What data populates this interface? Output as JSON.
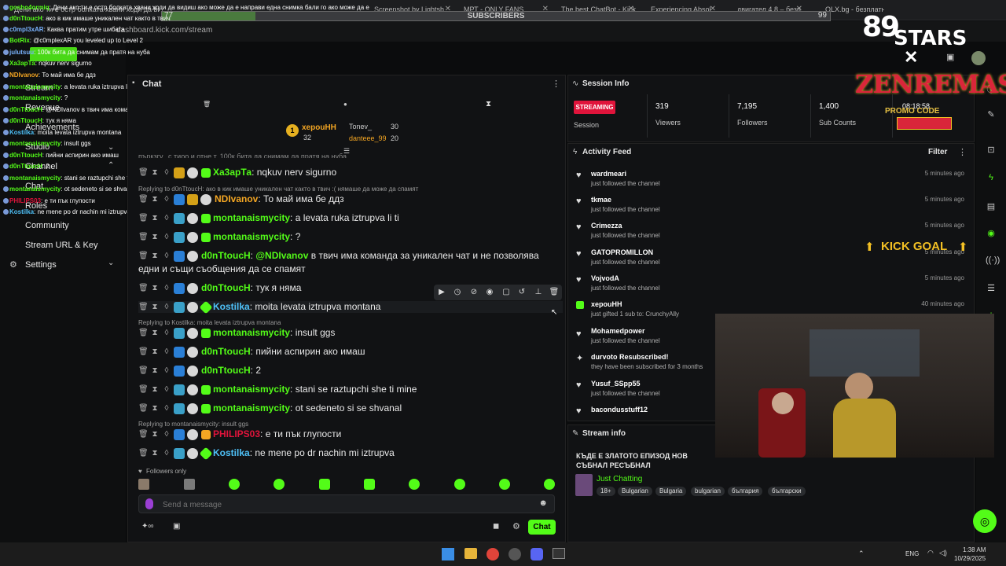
{
  "browser": {
    "tabs": [
      {
        "label": "Дени ако ти е остр болката хвани ходи да видиш ако може да е направи една снимка бали го ако може да е"
      },
      {
        "label": "Screenshot by Lightsh"
      },
      {
        "label": "МРТ - ONLY FANS"
      },
      {
        "label": "The best ChatBot - Kick..."
      },
      {
        "label": "Experiencing Absol..."
      },
      {
        "label": "двигател 4.8 – безп..."
      },
      {
        "label": "OLX.bg - безплатни..."
      }
    ],
    "url": "dashboard.kick.com/stream"
  },
  "subs_goal": {
    "label": "SUBSCRIBERS",
    "current": "77",
    "goal": "99",
    "progress": 0.14
  },
  "sidebar": {
    "items": [
      {
        "label": "Stream"
      },
      {
        "label": "Revenue"
      },
      {
        "label": "Achievements"
      },
      {
        "label": "Studio"
      },
      {
        "label": "Channel"
      },
      {
        "label": "Chat"
      },
      {
        "label": "Roles"
      },
      {
        "label": "Community"
      },
      {
        "label": "Stream URL & Key"
      },
      {
        "label": "Settings"
      }
    ]
  },
  "overlay_chat": [
    {
      "name": "gosho4ormiq",
      "text": ": Дени ако ти е остр болката хвани ходи да видиш ако може да е направи една снимка бали го ако може да е"
    },
    {
      "name": "d0nTtoucH",
      "text": ": ако в кик имаше уникален чат както в твич"
    },
    {
      "name": "c0mpl3xAR",
      "text": ": Каква пратим утре шибата"
    },
    {
      "name": "BotRix",
      "text": ": @c0mplexAR you leveled up to Level 2"
    },
    {
      "name": "julutsuu",
      "text": ": 100к бита да снимам да пратя на нуба"
    },
    {
      "name": "Ха3арТа",
      "text": ": nqkuv nerv sigurno"
    },
    {
      "name": "NDIvanov",
      "text": ": То май има бе ддз"
    },
    {
      "name": "montanaismycity",
      "text": ": a levata ruka iztrupva li ti"
    },
    {
      "name": "montanaismycity",
      "text": ": ?"
    },
    {
      "name": "d0nTtoucH",
      "text": ": @NDIvanov в твич има команда за уникален чат и не позволява едни и същи съобщения да се спамят"
    },
    {
      "name": "d0nTtoucH",
      "text": ": тук я няма"
    },
    {
      "name": "Kostilka",
      "text": ": moita levata iztrupva montana"
    },
    {
      "name": "montanaismycity",
      "text": ": insult ggs"
    },
    {
      "name": "d0nTtoucH",
      "text": ": пийни аспирин ако имаш"
    },
    {
      "name": "d0nTtoucH",
      "text": ": 2"
    },
    {
      "name": "montanaismycity",
      "text": ": stani se raztupchi she ti mine"
    },
    {
      "name": "montanaismycity",
      "text": ": ot sedeneto si se shvanal"
    },
    {
      "name": "PHILIPS03",
      "text": ": е ти пък глупости"
    },
    {
      "name": "Kostilka",
      "text": ": ne mene po dr nachin mi iztrupva"
    }
  ],
  "chat": {
    "title": "Chat",
    "pinned": {
      "rank1_name": "xepouHH",
      "rank1_count": "32",
      "rank2_name": "Tonev_",
      "rank2_count": "30",
      "rank3_name": "danteee_99",
      "rank3_count": "20"
    },
    "partial_top": "пъркзгу...с тиоо и отне т. 100к бита да снимам да пратя на нуба",
    "messages": [
      {
        "name": "Ха3арТа",
        "text": "nqkuv nerv sigurno",
        "color": "#53fc18"
      },
      {
        "name": "NDIvanov",
        "text": "То май има бе ддз",
        "color": "#f4a623",
        "reply": "Replying to d0nTtoucH: ако в кик имаше уникален чат както в твич :( нямаше да може да спамят"
      },
      {
        "name": "montanaismycity",
        "text": "a levata ruka iztrupva li ti",
        "color": "#53fc18"
      },
      {
        "name": "montanaismycity",
        "text": "?",
        "color": "#53fc18"
      },
      {
        "name": "d0nTtoucH",
        "text": "в твич има команда за уникален чат и не позволява",
        "text2": "едни и същи съобщения да се спамят",
        "mention": "@NDIvanov",
        "color": "#53fc18"
      },
      {
        "name": "d0nTtoucH",
        "text": "тук я няма",
        "color": "#53fc18"
      },
      {
        "name": "Kostilka",
        "text": "moita levata iztrupva montana",
        "color": "#4ec0f7"
      },
      {
        "name": "montanaismycity",
        "text": "insult ggs",
        "color": "#53fc18",
        "reply": "Replying to Kostilka: moita levata iztrupva montana"
      },
      {
        "name": "d0nTtoucH",
        "text": "пийни аспирин ако имаш",
        "color": "#53fc18"
      },
      {
        "name": "d0nTtoucH",
        "text": "2",
        "color": "#53fc18"
      },
      {
        "name": "montanaismycity",
        "text": "stani se raztupchi she ti mine",
        "color": "#53fc18"
      },
      {
        "name": "montanaismycity",
        "text": "ot sedeneto si se shvanal",
        "color": "#53fc18"
      },
      {
        "name": "PHILIPS03",
        "text": "е ти пък глупости",
        "color": "#e0143b",
        "reply": "Replying to montanaismycity: insult ggs"
      },
      {
        "name": "Kostilka",
        "text": "ne mene po dr nachin mi iztrupva",
        "color": "#4ec0f7"
      }
    ],
    "followers_only": "Followers only",
    "input_placeholder": "Send a message",
    "send_label": "Chat"
  },
  "session": {
    "title": "Session Info",
    "status": "STREAMING",
    "session_label": "Session",
    "viewers_value": "319",
    "viewers_label": "Viewers",
    "followers_value": "7,195",
    "followers_label": "Followers",
    "subs_value": "1,400",
    "subs_label": "Sub Counts"
  },
  "activity": {
    "title": "Activity Feed",
    "filter_label": "Filter",
    "items": [
      {
        "name": "wardmeari",
        "sub": "just followed the channel",
        "time": "5 minutes ago"
      },
      {
        "name": "tkmae",
        "sub": "just followed the channel",
        "time": "5 minutes ago"
      },
      {
        "name": "Crimezza",
        "sub": "just followed the channel",
        "time": "5 minutes ago"
      },
      {
        "name": "GATOPROMILLON",
        "sub": "just followed the channel",
        "time": "5 minutes ago"
      },
      {
        "name": "VojvodA",
        "sub": "just followed the channel",
        "time": "5 minutes ago"
      },
      {
        "name": "xepouHH",
        "sub": "just gifted 1 sub to: CrunchyAlly",
        "time": "40 minutes ago"
      },
      {
        "name": "Mohamedpower",
        "sub": "just followed the channel",
        "time": ""
      },
      {
        "name": "durvoto Resubscribed!",
        "sub": "they have been subscribed for 3 months",
        "time": ""
      },
      {
        "name": "Yusuf_SSpp55",
        "sub": "just followed the channel",
        "time": ""
      },
      {
        "name": "bacondusstuff12",
        "sub": "",
        "time": ""
      }
    ]
  },
  "stream_info": {
    "title": "Stream info",
    "stream_title_1": "КЪДЕ Е ЗЛАТОТО ЕПИЗОД НОВ",
    "stream_title_2": "СЪБНАЛ РЕСЪБНАЛ",
    "category": "Just Chatting",
    "tags": [
      "18+",
      "Bulgarian",
      "Bulgaria",
      "bulgarian",
      "българия",
      "български"
    ]
  },
  "overlays": {
    "logo_89": "89",
    "logo_stars": "STARS",
    "zen": "ZENREMASTA",
    "promo": "PROMO CODE",
    "promo_time": "08:18:58",
    "kick_goal": "KICK GOAL"
  },
  "taskbar": {
    "lang": "ENG",
    "time": "1:38 AM",
    "date": "10/29/2025"
  },
  "colors": {
    "kick_green": "#53fc18",
    "streaming_red": "#e0143b",
    "gold": "#f3c024"
  }
}
